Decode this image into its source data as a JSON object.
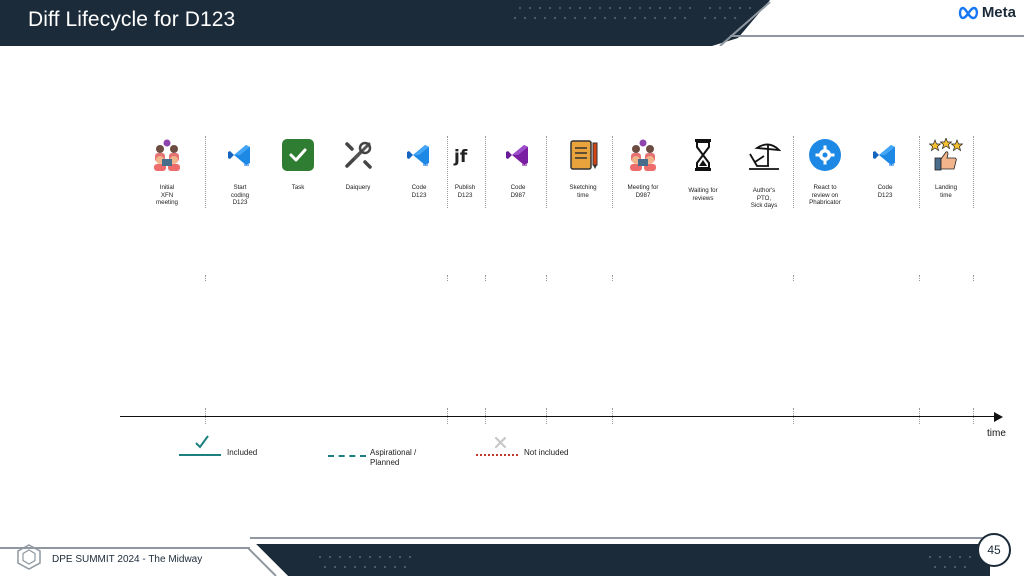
{
  "header": {
    "title": "Diff Lifecycle for D123",
    "logo_text": "Meta"
  },
  "footer": {
    "event": "DPE SUMMIT 2024 - The Midway",
    "page_number": "45"
  },
  "timeline": {
    "axis_label": "time",
    "items": [
      {
        "icon": "team-meeting-icon",
        "label": "Initial\nXFN\nmeeting"
      },
      {
        "icon": "vscode-icon",
        "label": "Start\ncoding\nD123"
      },
      {
        "icon": "green-check-task-icon",
        "label": "Task"
      },
      {
        "icon": "tools-icon",
        "label": "Daiquery"
      },
      {
        "icon": "vscode-icon",
        "label": "Code\nD123"
      },
      {
        "icon": "jf-icon",
        "label": "Publish\nD123"
      },
      {
        "icon": "visual-studio-icon",
        "label": "Code\nD987"
      },
      {
        "icon": "notebook-icon",
        "label": "Sketching\ntime"
      },
      {
        "icon": "team-meeting-icon",
        "label": "Meeting for\nD987"
      },
      {
        "icon": "hourglass-icon",
        "label": "Waiting for\nreviews"
      },
      {
        "icon": "beach-chair-icon",
        "label": "Author's\nPTO,\nSick days"
      },
      {
        "icon": "phabricator-gear-icon",
        "label": "React to\nreview on\nPhabricator"
      },
      {
        "icon": "vscode-icon",
        "label": "Code\nD123"
      },
      {
        "icon": "thumbs-up-stars-icon",
        "label": "Landing\ntime"
      }
    ]
  },
  "legend": {
    "included": "Included",
    "aspirational": "Aspirational /\nPlanned",
    "not_included": "Not included"
  },
  "colors": {
    "dark": "#1c2b39",
    "teal": "#1e7f80",
    "red_dotted": "#c0392b"
  }
}
